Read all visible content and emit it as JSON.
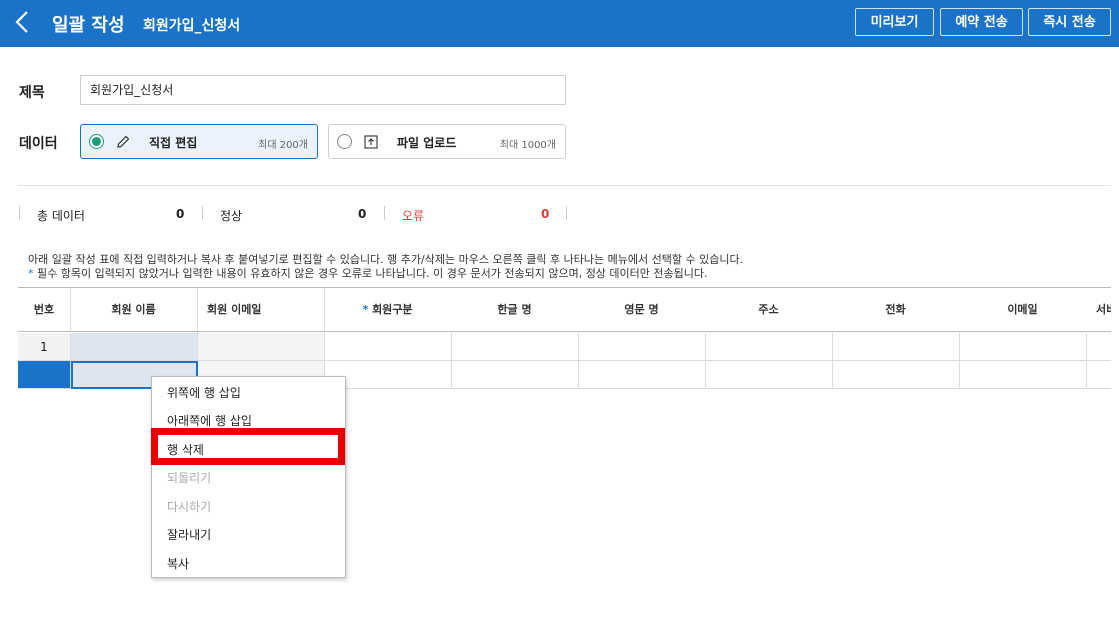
{
  "header": {
    "title": "일괄 작성",
    "subtitle": "회원가입_신청서",
    "buttons": {
      "preview": "미리보기",
      "schedule": "예약 전송",
      "send_now": "즉시 전송"
    },
    "color": "#1a73c9"
  },
  "form": {
    "subject_label": "제목",
    "subject_value": "회원가입_신청서",
    "data_label": "데이터",
    "options": [
      {
        "label": "직접 편집",
        "max": "최대 200개",
        "selected": true,
        "icon": "pencil-icon"
      },
      {
        "label": "파일 업로드",
        "max": "최대 1000개",
        "selected": false,
        "icon": "upload-icon"
      }
    ]
  },
  "stats": {
    "total_label": "총 데이터",
    "total_value": "0",
    "normal_label": "정상",
    "normal_value": "0",
    "error_label": "오류",
    "error_value": "0",
    "error_color": "#e53935"
  },
  "description": {
    "line1": "아래 일괄 작성 표에 직접 입력하거나 복사 후 붙여넣기로 편집할 수 있습니다. 행 추가/삭제는 마우스 오른쪽 클릭 후 나타나는 메뉴에서 선택할 수 있습니다.",
    "line2_star": "*",
    "line2": " 필수 항목이 입력되지 않았거나 입력한 내용이 유효하지 않은 경우 오류로 나타납니다. 이 경우 문서가 전송되지 않으며, 정상 데이터만 전송됩니다."
  },
  "grid": {
    "columns": [
      "번호",
      "회원 이름",
      "회원 이메일",
      "회원구분",
      "한글 명",
      "영문 명",
      "주소",
      "전화",
      "이메일",
      "서비"
    ],
    "required_star": "*",
    "rows": [
      "1",
      ""
    ]
  },
  "context_menu": {
    "items": [
      {
        "label": "위쪽에 행 삽입",
        "disabled": false
      },
      {
        "label": "아래쪽에 행 삽입",
        "disabled": false
      },
      {
        "label": "행 삭제",
        "disabled": false
      },
      {
        "label": "되돌리기",
        "disabled": true
      },
      {
        "label": "다시하기",
        "disabled": true
      },
      {
        "label": "잘라내기",
        "disabled": false
      },
      {
        "label": "복사",
        "disabled": false
      }
    ],
    "highlight_color": "#e80000"
  }
}
